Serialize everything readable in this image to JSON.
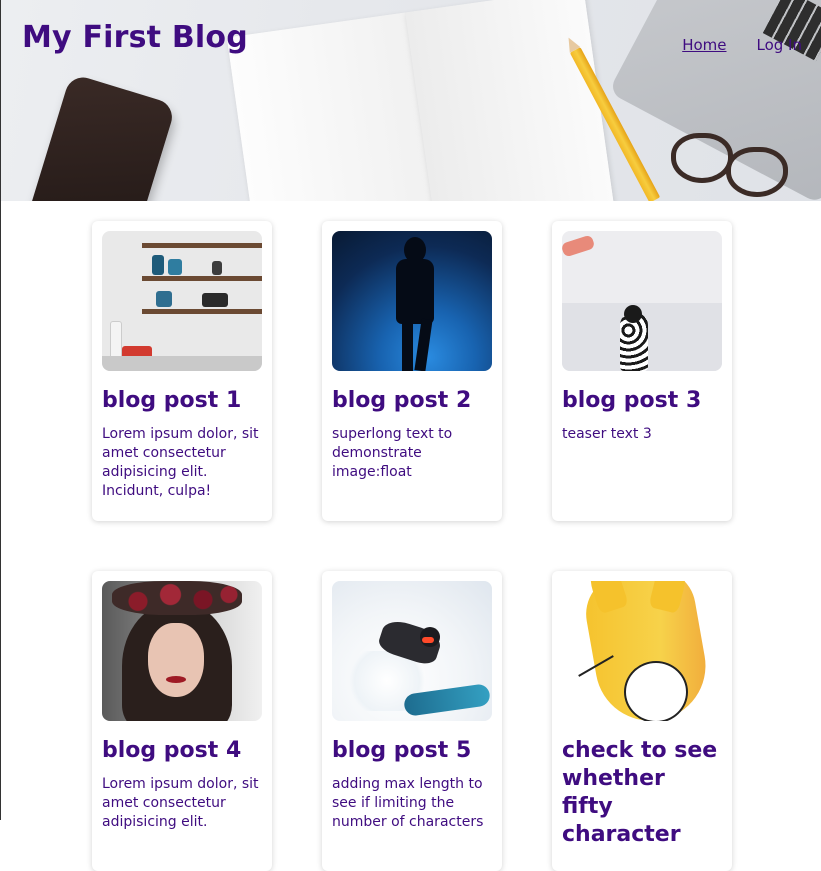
{
  "header": {
    "site_title": "My First Blog",
    "nav": [
      {
        "label": "Home",
        "active": true
      },
      {
        "label": "Log In",
        "active": false
      }
    ]
  },
  "colors": {
    "brand": "#3f0c80",
    "background": "#ffffff"
  },
  "posts": [
    {
      "title": "blog post 1",
      "teaser": "Lorem ipsum dolor, sit amet consectetur adipisicing elit. Incidunt, culpa!",
      "image": "kitchen-shelves-image"
    },
    {
      "title": "blog post 2",
      "teaser": "superlong text to demonstrate image:float",
      "image": "silhouette-image"
    },
    {
      "title": "blog post 3",
      "teaser": "teaser text 3",
      "image": "dog-image"
    },
    {
      "title": "blog post 4",
      "teaser": "Lorem ipsum dolor, sit amet consectetur adipisicing elit.",
      "image": "portrait-image"
    },
    {
      "title": "blog post 5",
      "teaser": "adding max length to see if limiting the number of characters",
      "image": "snowboard-image"
    },
    {
      "title": "check to see whether fifty character",
      "teaser": "",
      "image": "cartoon-image"
    }
  ]
}
